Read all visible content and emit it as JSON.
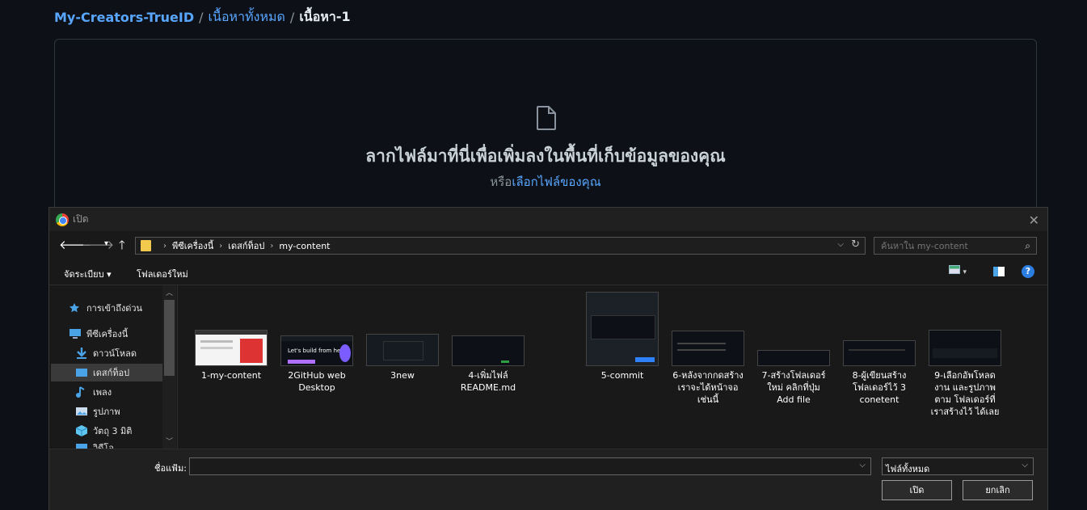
{
  "breadcrumb": {
    "repo": "My-Creators-TrueID",
    "folder": "เนื้อหาทั้งหมด",
    "sep": "/",
    "current": "เนื้อหา-1"
  },
  "dropzone": {
    "title": "ลากไฟล์มาที่นี่เพื่อเพิ่มลงในพื้นที่เก็บข้อมูลของคุณ",
    "subtitle_prefix": "หรือ",
    "subtitle_link": "เลือกไฟล์ของคุณ"
  },
  "dialog": {
    "title": "เปิด",
    "address": [
      "พีซีเครื่องนี้",
      "เดสก์ท็อป",
      "my-content"
    ],
    "search_placeholder": "ค้นหาใน my-content",
    "toolbar": {
      "organize": "จัดระเบียบ",
      "new_folder": "โฟลเดอร์ใหม่"
    },
    "nav_items": [
      {
        "label": "การเข้าถึงด่วน",
        "icon": "star-icon"
      },
      {
        "label": "พีซีเครื่องนี้",
        "icon": "computer-icon"
      },
      {
        "label": "ดาวน์โหลด",
        "icon": "download-icon"
      },
      {
        "label": "เดสก์ท็อป",
        "icon": "desktop-icon",
        "selected": true
      },
      {
        "label": "เพลง",
        "icon": "music-icon"
      },
      {
        "label": "รูปภาพ",
        "icon": "pictures-icon"
      },
      {
        "label": "วัตถุ 3 มิติ",
        "icon": "cube-icon"
      },
      {
        "label": "วิดีโอ",
        "icon": "video-icon"
      }
    ],
    "files": [
      {
        "name": "1-my-content"
      },
      {
        "name": "2GitHub web Desktop"
      },
      {
        "name": "3new"
      },
      {
        "name": "4-เพิ่มไฟล์ README.md"
      },
      {
        "name": "5-commit"
      },
      {
        "name": "6-หลังจากกดสร้าง เราจะได้หน้าจอเช่นนี้"
      },
      {
        "name": "7-สร้างโฟลเดอร์ใหม่ คลิกที่ปุ่ม Add file"
      },
      {
        "name": "8-ผู้เขียนสร้าง โฟลเดอร์ไว้ 3 conetent"
      },
      {
        "name": "9-เลือกอัพโหลดงาน และรูปภาพตาม โฟลเดอร์ที่เราสร้างไว้ ได้เลย"
      }
    ],
    "thumb_caption": "Let's build from here",
    "filename_label": "ชื่อแฟ้ม:",
    "filename_value": "",
    "filetype": "ไฟล์ทั้งหมด",
    "open_button": "เปิด",
    "cancel_button": "ยกเลิก"
  }
}
